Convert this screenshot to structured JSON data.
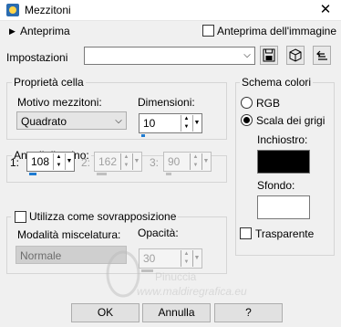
{
  "window": {
    "title": "Mezzitoni",
    "close_glyph": "✕"
  },
  "preview": {
    "label": "Anteprima",
    "expand_glyph": "▶"
  },
  "image_preview": {
    "label": "Anteprima dell'immagine",
    "checked": false
  },
  "presets": {
    "label": "Impostazioni",
    "value": "",
    "chevron": "⌵"
  },
  "cell_properties": {
    "title": "Proprietà cella",
    "pattern_label": "Motivo mezzitoni:",
    "pattern_value": "Quadrato",
    "size_label": "Dimensioni:",
    "size_value": "10",
    "size_fraction": 0.05
  },
  "screen_angles": {
    "title": "Angoli di retino:",
    "items": [
      {
        "label": "1:",
        "value": "108",
        "fraction": 0.3,
        "disabled": false
      },
      {
        "label": "2:",
        "value": "162",
        "fraction": 0.45,
        "disabled": true
      },
      {
        "label": "3:",
        "value": "90",
        "fraction": 0.25,
        "disabled": true
      }
    ]
  },
  "overlay": {
    "label": "Utilizza come sovrapposizione",
    "checked": false,
    "blend_label": "Modalità miscelatura:",
    "blend_value": "Normale",
    "opacity_label": "Opacità:",
    "opacity_value": "30",
    "opacity_fraction": 0.3
  },
  "color_scheme": {
    "title": "Schema colori",
    "options": [
      {
        "label": "RGB",
        "selected": false
      },
      {
        "label": "Scala dei grigi",
        "selected": true
      }
    ],
    "ink_label": "Inchiostro:",
    "ink_color": "#000000",
    "background_label": "Sfondo:",
    "background_color": "#ffffff",
    "transparent_label": "Trasparente",
    "transparent_checked": false
  },
  "buttons": {
    "ok": "OK",
    "cancel": "Annulla",
    "help": "?"
  },
  "watermark": {
    "line1": "Pinuccia",
    "line2": "www.maldiregrafica.eu"
  },
  "icons": {
    "save": "save-icon",
    "load": "cube-icon",
    "reset": "reset-icon"
  },
  "colors": {
    "accent": "#1e7bd1"
  }
}
